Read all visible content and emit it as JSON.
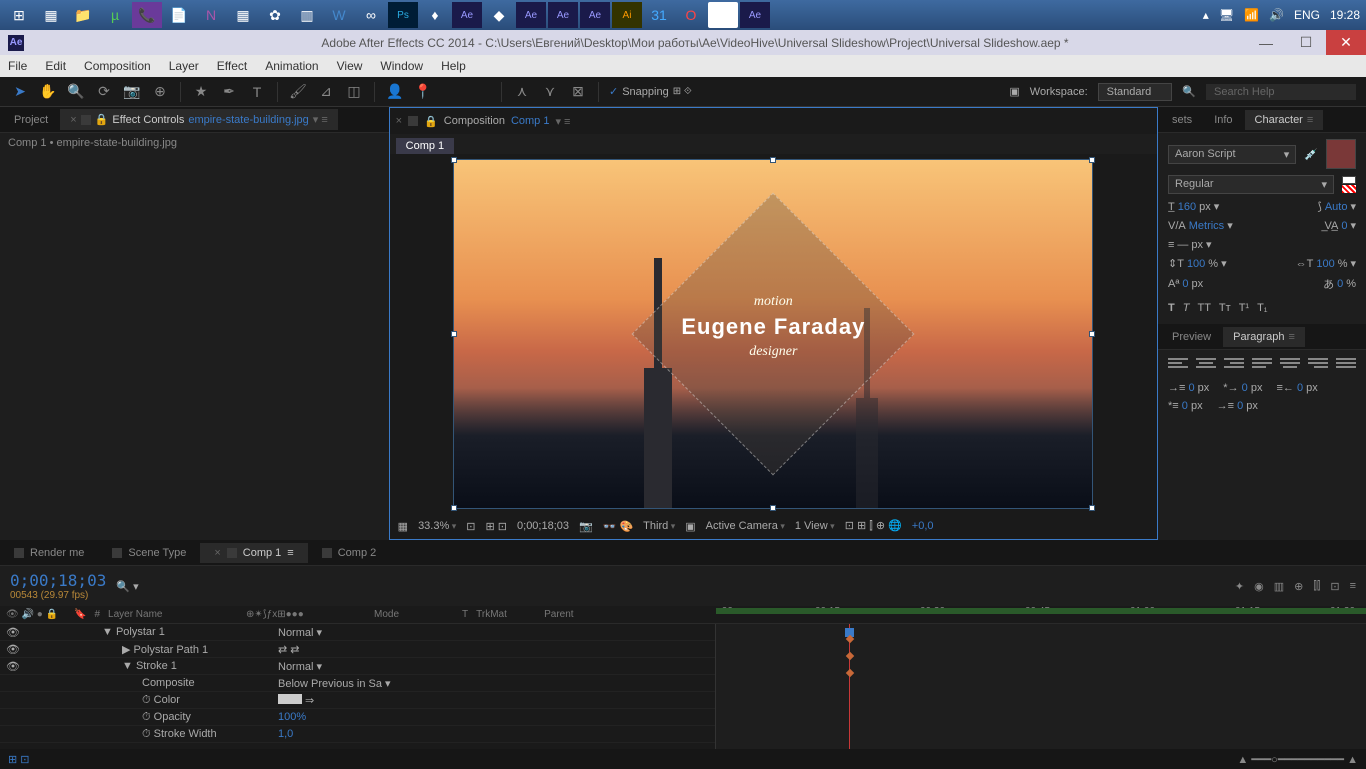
{
  "taskbar": {
    "lang": "ENG",
    "time": "19:28"
  },
  "titlebar": {
    "app_icon": "Ae",
    "text": "Adobe After Effects CC 2014 - C:\\Users\\Евгений\\Desktop\\Mои работы\\Ae\\VideoHive\\Universal Slideshow\\Project\\Universal Slideshow.aep *"
  },
  "menubar": [
    "File",
    "Edit",
    "Composition",
    "Layer",
    "Effect",
    "Animation",
    "View",
    "Window",
    "Help"
  ],
  "toolbar": {
    "snapping": "Snapping",
    "workspace_label": "Workspace:",
    "workspace_value": "Standard",
    "search_placeholder": "Search Help"
  },
  "left": {
    "tab_project": "Project",
    "tab_effect": "Effect Controls",
    "effect_target": "empire-state-building.jpg",
    "sub": "Comp 1 • empire-state-building.jpg"
  },
  "comp": {
    "panel_label": "Composition",
    "panel_target": "Comp 1",
    "crumb": "Comp 1",
    "overlay1": "motion",
    "overlay2": "Eugene Faraday",
    "overlay3": "designer",
    "footer": {
      "zoom": "33.3%",
      "time": "0;00;18;03",
      "quality": "Third",
      "camera": "Active Camera",
      "view": "1 View",
      "exposure": "+0,0"
    }
  },
  "right": {
    "tabs": {
      "sets": "sets",
      "info": "Info",
      "character": "Character"
    },
    "font": "Aaron Script",
    "style": "Regular",
    "size": "160",
    "size_unit": "px",
    "leading": "Auto",
    "kerning": "Metrics",
    "tracking": "0",
    "line_unit": "px",
    "vscale": "100",
    "hscale": "100",
    "baseline": "0",
    "tsume": "0",
    "pct": "%",
    "px": "px",
    "preview_tab": "Preview",
    "paragraph_tab": "Paragraph",
    "indent0": "0",
    "px2": "px"
  },
  "timeline": {
    "tabs": {
      "render": "Render me",
      "scene": "Scene Type",
      "comp1": "Comp 1",
      "comp2": "Comp 2"
    },
    "timecode": "0;00;18;03",
    "frameinfo": "00543 (29.97 fps)",
    "cols": {
      "layer_name": "Layer Name",
      "mode": "Mode",
      "trkmat": "TrkMat",
      "parent": "Parent",
      "t": "T",
      "hash": "#"
    },
    "layers": [
      {
        "name": "Polystar 1",
        "mode": "Normal",
        "twirl": "▼"
      },
      {
        "name": "Polystar Path 1",
        "mode": "",
        "twirl": "▶"
      },
      {
        "name": "Stroke 1",
        "mode": "Normal",
        "twirl": "▼"
      },
      {
        "name": "Composite",
        "mode": "Below Previous in Sa",
        "twirl": ""
      },
      {
        "name": "Color",
        "mode": "",
        "twirl": ""
      },
      {
        "name": "Opacity",
        "mode": "100%",
        "twirl": ""
      },
      {
        "name": "Stroke Width",
        "mode": "1,0",
        "twirl": ""
      }
    ],
    "ruler": [
      ":00s",
      "00:15s",
      "00:30s",
      "00:45s",
      "01:00s",
      "01:15s",
      "01:30"
    ]
  }
}
